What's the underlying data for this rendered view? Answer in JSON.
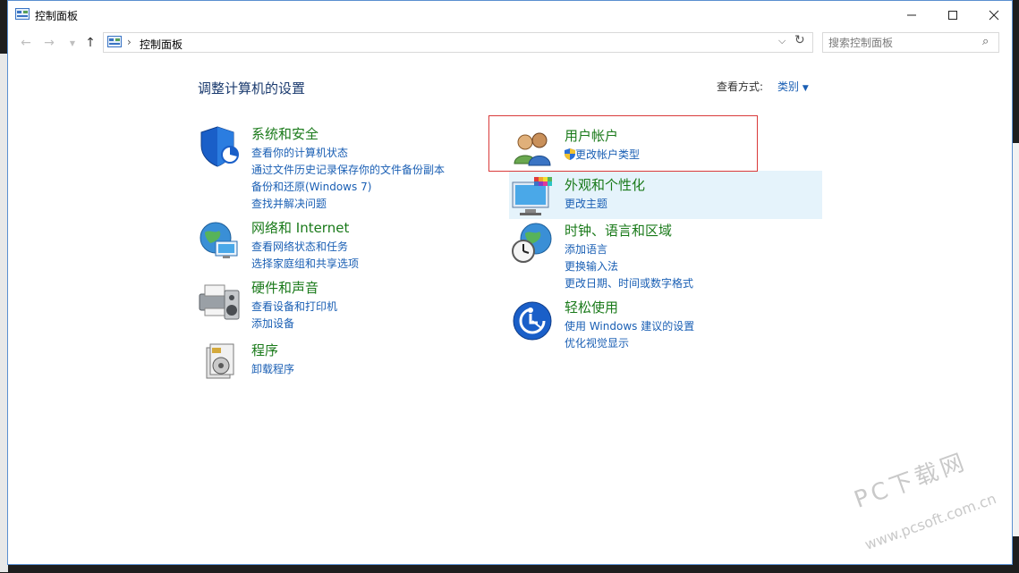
{
  "window": {
    "title": "控制面板"
  },
  "titlebar": {
    "minimize_icon": "minimize-icon",
    "maximize_icon": "maximize-icon",
    "close_icon": "close-icon"
  },
  "address": {
    "crumb": "控制面板",
    "separator": "›"
  },
  "search": {
    "placeholder": "搜索控制面板"
  },
  "main": {
    "heading": "调整计算机的设置",
    "view_by_label": "查看方式:",
    "view_by_value": "类别"
  },
  "categories_left": [
    {
      "title": "系统和安全",
      "icon": "shield-icon",
      "links": [
        "查看你的计算机状态",
        "通过文件历史记录保存你的文件备份副本",
        "备份和还原(Windows 7)",
        "查找并解决问题"
      ]
    },
    {
      "title": "网络和 Internet",
      "icon": "globe-network-icon",
      "links": [
        "查看网络状态和任务",
        "选择家庭组和共享选项"
      ]
    },
    {
      "title": "硬件和声音",
      "icon": "printer-speaker-icon",
      "links": [
        "查看设备和打印机",
        "添加设备"
      ]
    },
    {
      "title": "程序",
      "icon": "programs-icon",
      "links": [
        "卸载程序"
      ]
    }
  ],
  "categories_right": [
    {
      "title": "用户帐户",
      "icon": "users-icon",
      "links": [
        "更改帐户类型"
      ]
    },
    {
      "title": "外观和个性化",
      "icon": "monitor-palette-icon",
      "links": [
        "更改主题"
      ]
    },
    {
      "title": "时钟、语言和区域",
      "icon": "clock-globe-icon",
      "links": [
        "添加语言",
        "更换输入法",
        "更改日期、时间或数字格式"
      ]
    },
    {
      "title": "轻松使用",
      "icon": "accessibility-icon",
      "links": [
        "使用 Windows 建议的设置",
        "优化视觉显示"
      ]
    }
  ],
  "watermark": {
    "line1": "PC下载网",
    "line2": "www.pcsoft.com.cn"
  },
  "colors": {
    "category_title": "#1a7a1a",
    "link": "#1a5fb4",
    "highlight": "#d93a3a",
    "hover": "#e5f3fb"
  }
}
